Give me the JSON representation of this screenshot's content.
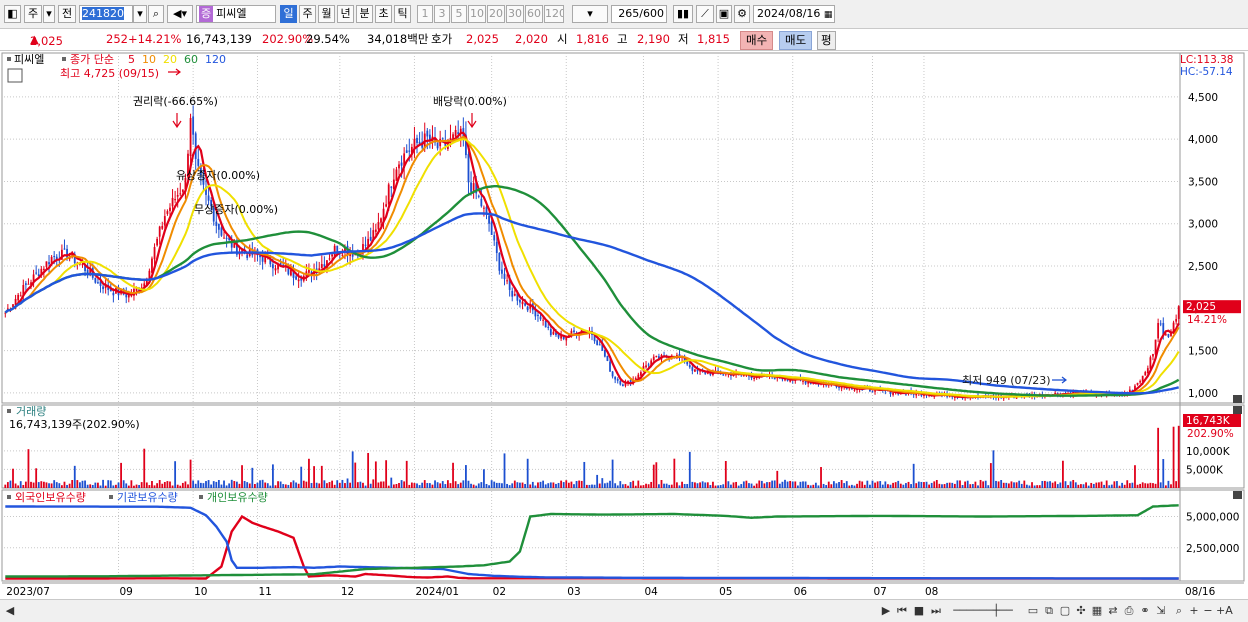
{
  "toolbar": {
    "market": "주",
    "period_prev": "전",
    "code": "241820",
    "name_tag": "증",
    "name": "피씨엘",
    "periods": [
      "일",
      "주",
      "월",
      "년",
      "분",
      "초",
      "틱"
    ],
    "selected_period": "일",
    "intervals": [
      "1",
      "3",
      "5",
      "10",
      "20",
      "30",
      "60",
      "120"
    ],
    "count": "265",
    "count_total": "/600",
    "date": "2024/08/16"
  },
  "quote": {
    "price": "2,025",
    "change": "252",
    "change_pct": "+14.21%",
    "volume": "16,743,139",
    "vol_ratio": "202.90%",
    "turnover": "29.54%",
    "amount": "34,018백만",
    "ask_label": "호가",
    "ask": "2,025",
    "bid": "2,020",
    "open_label": "시",
    "open": "1,816",
    "high_label": "고",
    "high": "2,190",
    "low_label": "저",
    "low": "1,815",
    "buy_btn": "매수",
    "sell_btn": "매도",
    "avg_btn": "평"
  },
  "price_panel": {
    "title": "피씨엘",
    "ma_label": "종가 단순",
    "ma": [
      {
        "period": "5",
        "color": "#e0001a"
      },
      {
        "period": "10",
        "color": "#f08c00"
      },
      {
        "period": "20",
        "color": "#f0e000"
      },
      {
        "period": "60",
        "color": "#1f8f3a"
      },
      {
        "period": "120",
        "color": "#2255dd"
      }
    ],
    "lc": "LC:113.38",
    "hc": "HC:-57.14",
    "last_price_box": "2,025",
    "last_pct": "14.21%",
    "high_marker": "최고 4,725 (09/15)",
    "low_marker": "최저 949 (07/23)",
    "annotations": [
      "권리락(-66.65%)",
      "유상증자(0.00%)",
      "무상증자(0.00%)",
      "배당락(0.00%)"
    ]
  },
  "volume_panel": {
    "title": "거래량",
    "value": "16,743,139주(202.90%)",
    "last_box": "16,743K",
    "last_pct": "202.90%"
  },
  "holdings_panel": {
    "series": [
      {
        "name": "외국인보유수량",
        "color": "#e0001a"
      },
      {
        "name": "기관보유수량",
        "color": "#2255dd"
      },
      {
        "name": "개인보유수량",
        "color": "#1f8f3a"
      }
    ]
  },
  "chart_data": [
    {
      "type": "candlestick",
      "title": "피씨엘",
      "y_ticks": [
        "4,500",
        "4,000",
        "3,500",
        "3,000",
        "2,500",
        "2,000",
        "1,500",
        "1,000"
      ],
      "ylim": [
        880,
        4830
      ],
      "x_ticks": [
        "2023/07",
        "09",
        "10",
        "11",
        "12",
        "2024/01",
        "02",
        "03",
        "04",
        "05",
        "06",
        "07",
        "08",
        "08/16"
      ],
      "close_path": [
        [
          0,
          1950
        ],
        [
          6,
          2200
        ],
        [
          12,
          2400
        ],
        [
          18,
          2600
        ],
        [
          24,
          2650
        ],
        [
          30,
          2500
        ],
        [
          36,
          2300
        ],
        [
          42,
          2200
        ],
        [
          48,
          2150
        ],
        [
          54,
          2300
        ],
        [
          58,
          2700
        ],
        [
          62,
          3100
        ],
        [
          66,
          3300
        ],
        [
          70,
          3500
        ],
        [
          72,
          4300
        ],
        [
          74,
          3700
        ],
        [
          76,
          3500
        ],
        [
          78,
          3300
        ],
        [
          80,
          3200
        ],
        [
          82,
          3000
        ],
        [
          86,
          2800
        ],
        [
          90,
          2700
        ],
        [
          94,
          2650
        ],
        [
          100,
          2600
        ],
        [
          106,
          2500
        ],
        [
          112,
          2400
        ],
        [
          116,
          2380
        ],
        [
          120,
          2450
        ],
        [
          124,
          2550
        ],
        [
          128,
          2700
        ],
        [
          132,
          2700
        ],
        [
          136,
          2650
        ],
        [
          140,
          2750
        ],
        [
          144,
          2900
        ],
        [
          148,
          3300
        ],
        [
          152,
          3700
        ],
        [
          156,
          3850
        ],
        [
          160,
          3950
        ],
        [
          164,
          4000
        ],
        [
          168,
          3900
        ],
        [
          172,
          3950
        ],
        [
          176,
          4050
        ],
        [
          178,
          4000
        ],
        [
          180,
          3500
        ],
        [
          184,
          3300
        ],
        [
          188,
          3000
        ],
        [
          192,
          2500
        ],
        [
          196,
          2200
        ],
        [
          200,
          2100
        ],
        [
          204,
          2000
        ],
        [
          208,
          1900
        ],
        [
          212,
          1700
        ],
        [
          216,
          1650
        ],
        [
          220,
          1700
        ],
        [
          224,
          1750
        ],
        [
          228,
          1700
        ],
        [
          232,
          1500
        ],
        [
          236,
          1200
        ],
        [
          240,
          1100
        ],
        [
          244,
          1150
        ],
        [
          248,
          1300
        ],
        [
          252,
          1400
        ],
        [
          256,
          1420
        ],
        [
          260,
          1450
        ],
        [
          264,
          1380
        ],
        [
          268,
          1250
        ],
        [
          272,
          1240
        ],
        [
          278,
          1230
        ],
        [
          284,
          1220
        ],
        [
          290,
          1200
        ],
        [
          296,
          1190
        ],
        [
          302,
          1180
        ],
        [
          308,
          1150
        ],
        [
          314,
          1120
        ],
        [
          320,
          1100
        ],
        [
          326,
          1080
        ],
        [
          332,
          1050
        ],
        [
          338,
          1030
        ],
        [
          344,
          1010
        ],
        [
          350,
          1000
        ],
        [
          356,
          990
        ],
        [
          362,
          980
        ],
        [
          368,
          970
        ],
        [
          374,
          960
        ],
        [
          380,
          950
        ],
        [
          386,
          955
        ],
        [
          392,
          960
        ],
        [
          398,
          970
        ],
        [
          404,
          980
        ],
        [
          410,
          990
        ],
        [
          416,
          1000
        ],
        [
          422,
          1000
        ],
        [
          428,
          980
        ],
        [
          434,
          975
        ],
        [
          438,
          1050
        ],
        [
          442,
          1200
        ],
        [
          446,
          1450
        ],
        [
          448,
          1850
        ],
        [
          450,
          1700
        ],
        [
          452,
          1650
        ],
        [
          454,
          1800
        ],
        [
          456,
          2025
        ]
      ],
      "ma_series": [
        "5",
        "10",
        "20",
        "60",
        "120"
      ]
    },
    {
      "type": "bar",
      "title": "거래량",
      "y_ticks": [
        "10,000K",
        "5,000K"
      ],
      "ylim": [
        0,
        17500000
      ],
      "last_value": 16743139
    },
    {
      "type": "line",
      "title": "보유수량",
      "y_ticks": [
        "5,000,000",
        "2,500,000"
      ],
      "series": [
        {
          "name": "외국인보유수량",
          "points": [
            [
              0,
              40
            ],
            [
              30,
              35
            ],
            [
              60,
              60
            ],
            [
              78,
              40
            ],
            [
              84,
              1000
            ],
            [
              88,
              3800
            ],
            [
              92,
              5000
            ],
            [
              96,
              4500
            ],
            [
              100,
              4200
            ],
            [
              106,
              3800
            ],
            [
              112,
              3300
            ],
            [
              116,
              1000
            ],
            [
              118,
              200
            ],
            [
              126,
              300
            ],
            [
              136,
              200
            ],
            [
              140,
              400
            ],
            [
              148,
              300
            ],
            [
              158,
              150
            ],
            [
              164,
              120
            ],
            [
              172,
              200
            ],
            [
              176,
              100
            ],
            [
              180,
              60
            ],
            [
              200,
              60
            ],
            [
              260,
              50
            ],
            [
              360,
              40
            ],
            [
              456,
              30
            ]
          ]
        },
        {
          "name": "기관보유수량",
          "points": [
            [
              0,
              5800
            ],
            [
              60,
              5780
            ],
            [
              72,
              5700
            ],
            [
              78,
              5100
            ],
            [
              82,
              4200
            ],
            [
              86,
              3000
            ],
            [
              88,
              1500
            ],
            [
              90,
              900
            ],
            [
              100,
              900
            ],
            [
              112,
              950
            ],
            [
              120,
              900
            ],
            [
              130,
              1000
            ],
            [
              140,
              950
            ],
            [
              150,
              900
            ],
            [
              160,
              850
            ],
            [
              170,
              800
            ],
            [
              180,
              400
            ],
            [
              190,
              250
            ],
            [
              200,
              180
            ],
            [
              210,
              130
            ],
            [
              220,
              120
            ],
            [
              240,
              100
            ],
            [
              300,
              80
            ],
            [
              360,
              60
            ],
            [
              420,
              50
            ],
            [
              456,
              40
            ]
          ]
        },
        {
          "name": "개인보유수량",
          "points": [
            [
              0,
              200
            ],
            [
              40,
              220
            ],
            [
              80,
              300
            ],
            [
              120,
              380
            ],
            [
              140,
              800
            ],
            [
              160,
              900
            ],
            [
              176,
              1000
            ],
            [
              186,
              1100
            ],
            [
              196,
              1400
            ],
            [
              200,
              2200
            ],
            [
              204,
              5000
            ],
            [
              212,
              5200
            ],
            [
              232,
              5150
            ],
            [
              260,
              5200
            ],
            [
              280,
              5050
            ],
            [
              290,
              4900
            ],
            [
              300,
              5000
            ],
            [
              340,
              5050
            ],
            [
              380,
              5000
            ],
            [
              420,
              5050
            ],
            [
              440,
              5100
            ],
            [
              446,
              5800
            ],
            [
              456,
              5900
            ]
          ]
        }
      ],
      "ylim": [
        0,
        6000
      ]
    }
  ]
}
